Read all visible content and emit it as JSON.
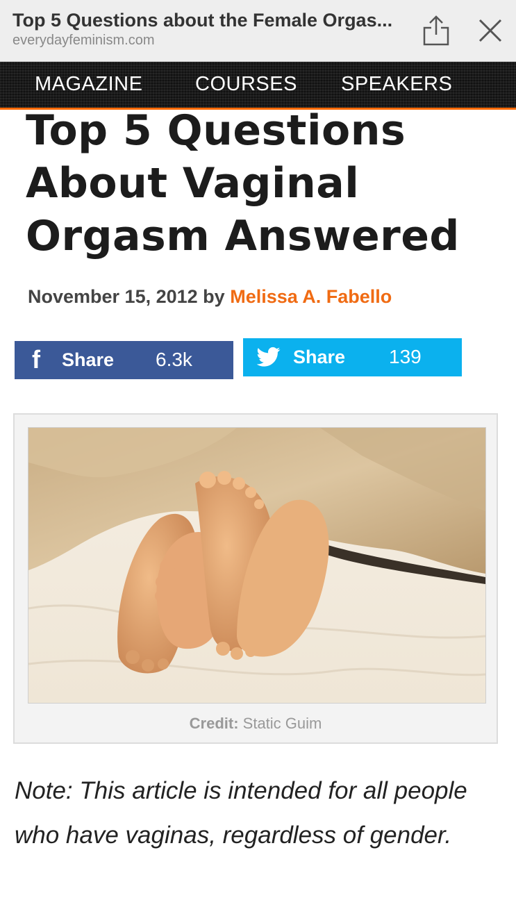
{
  "browser": {
    "page_title": "Top 5 Questions about the Female Orgas...",
    "url": "everydayfeminism.com",
    "share_icon": "share-icon",
    "close_icon": "close-icon"
  },
  "nav": {
    "items": [
      "MAGAZINE",
      "COURSES",
      "SPEAKERS"
    ],
    "accent_color": "#ff6a00"
  },
  "article": {
    "title": "Top 5 Questions About Vaginal Orgasm Answered",
    "date": "November 15, 2012",
    "by": "by",
    "author": "Melissa A. Fabello",
    "author_color": "#f06b13"
  },
  "share": {
    "facebook": {
      "icon": "f",
      "label": "Share",
      "count": "6.3k",
      "color": "#3b5998"
    },
    "twitter": {
      "label": "Share",
      "count": "139",
      "color": "#0bb1ee"
    }
  },
  "figure": {
    "image_icon": "photo-feet-under-blanket",
    "credit_label": "Credit:",
    "credit_name": "Static Guim"
  },
  "note": "Note: This article is intended for all people who have vaginas, regardless of gender."
}
